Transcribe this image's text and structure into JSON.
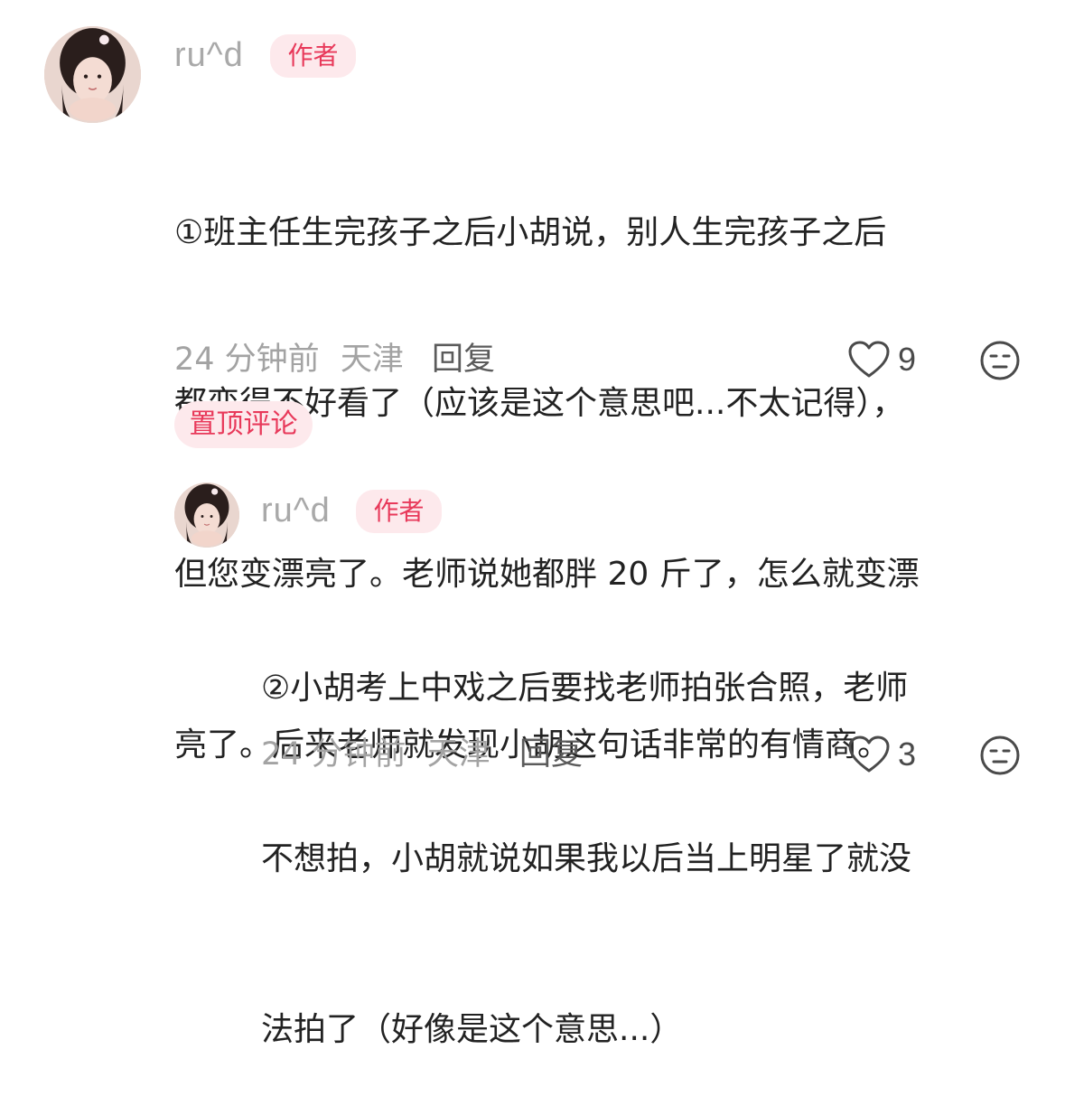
{
  "comments": [
    {
      "author": "ru^d",
      "badge": "作者",
      "text": "①班主任生完孩子之后小胡说，别人生完孩子之后都变得不好看了（应该是这个意思吧...不太记得），但您变漂亮了。老师说她都胖 20 斤了，怎么就变漂亮了。后来老师就发现小胡这句话非常的有情商。",
      "lines": [
        "①班主任生完孩子之后小胡说，别人生完孩子之后",
        "都变得不好看了（应该是这个意思吧...不太记得），",
        "但您变漂亮了。老师说她都胖 20 斤了，怎么就变漂",
        "亮了。后来老师就发现小胡这句话非常的有情商。"
      ],
      "time": "24 分钟前",
      "location": "天津",
      "reply_label": "回复",
      "likes": "9",
      "like_icon": "heart-outline-icon",
      "dislike_icon": "meh-face-icon",
      "pin_label": "置顶评论"
    },
    {
      "author": "ru^d",
      "badge": "作者",
      "text": "②小胡考上中戏之后要找老师拍张合照，老师不想拍，小胡就说如果我以后当上明星了就没法拍了（好像是这个意思...）",
      "lines": [
        "②小胡考上中戏之后要找老师拍张合照，老师",
        "不想拍，小胡就说如果我以后当上明星了就没",
        "法拍了（好像是这个意思...）"
      ],
      "time": "24 分钟前",
      "location": "天津",
      "reply_label": "回复",
      "likes": "3",
      "like_icon": "heart-outline-icon",
      "dislike_icon": "meh-face-icon"
    }
  ],
  "colors": {
    "accent": "#e8395a",
    "badge_bg": "#fde9ec",
    "meta": "#a3a3a3"
  }
}
